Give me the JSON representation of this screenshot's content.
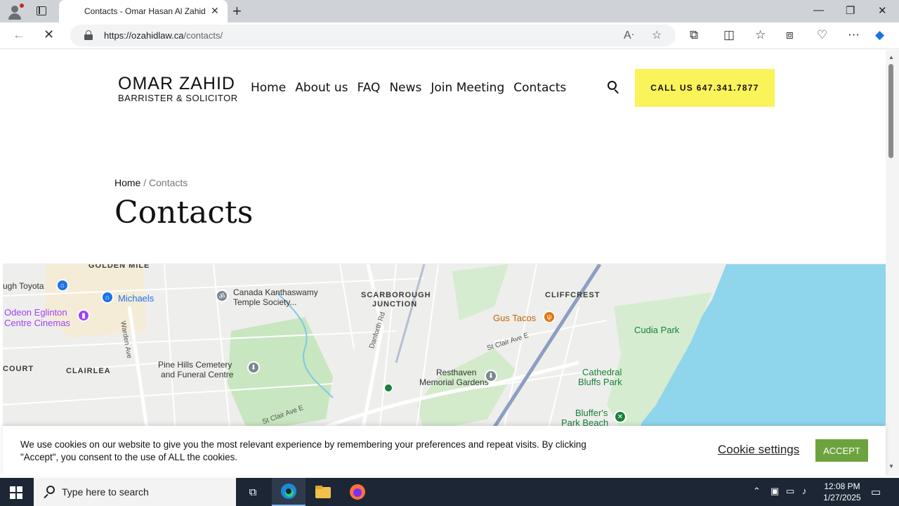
{
  "browser": {
    "tab_title": "Contacts - Omar Hasan Al Zahid",
    "url_host": "https://ozahidlaw.ca",
    "url_path": "/contacts/"
  },
  "site": {
    "logo_line1": "OMAR ZAHID",
    "logo_line2": "BARRISTER & SOLICITOR",
    "nav": [
      "Home",
      "About us",
      "FAQ",
      "News",
      "Join Meeting",
      "Contacts"
    ],
    "call_button": "CALL US 647.341.7877",
    "breadcrumb_home": "Home",
    "breadcrumb_sep": "/",
    "breadcrumb_current": "Contacts",
    "page_title": "Contacts"
  },
  "map": {
    "labels": {
      "golden_mile": "GOLDEN MILE",
      "toyota": "ugh Toyota",
      "michaels": "Michaels",
      "odeon1": "Odeon Eglinton",
      "odeon2": "Centre Cinemas",
      "warden": "Warden Ave",
      "court": "COURT",
      "clairlea": "CLAIRLEA",
      "kanthaswamy1": "Canada Kanthaswamy",
      "kanthaswamy2": "Temple Society...",
      "pinehills1": "Pine Hills Cemetery",
      "pinehills2": "and Funeral Centre",
      "scarborough1": "SCARBOROUGH",
      "scarborough2": "JUNCTION",
      "danforth": "Danforth Rd",
      "stclair1": "St Clair Ave E",
      "stclair2": "St Clair Ave E",
      "resthaven1": "Resthaven",
      "resthaven2": "Memorial Gardens",
      "cliffcrest": "CLIFFCREST",
      "gustacos": "Gus Tacos",
      "cudia": "Cudia Park",
      "cathedral1": "Cathedral",
      "cathedral2": "Bluffs Park",
      "bluffers1": "Bluffer's",
      "bluffers2": "Park Beach"
    }
  },
  "cookie": {
    "message": "We use cookies on our website to give you the most relevant experience by remembering your preferences and repeat visits. By clicking \"Accept\", you consent to the use of ALL the cookies.",
    "settings_label": "Cookie settings",
    "accept_label": "ACCEPT"
  },
  "taskbar": {
    "search_placeholder": "Type here to search",
    "time": "12:08 PM",
    "date": "1/27/2025"
  }
}
